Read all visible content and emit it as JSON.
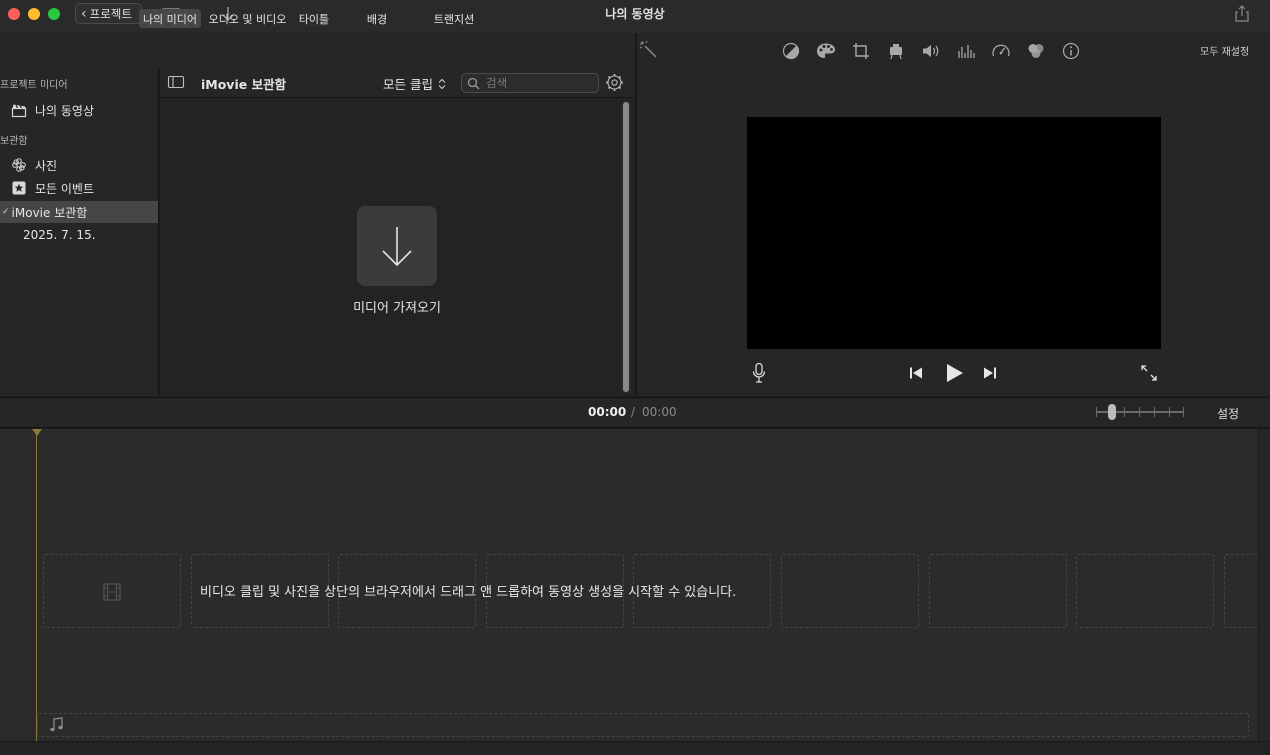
{
  "window": {
    "title": "나의 동영상",
    "back_label": "프로젝트",
    "traffic_colors": [
      "#ff5f57",
      "#febc2e",
      "#28c840"
    ]
  },
  "browser_tabs": [
    {
      "label": "나의 미디어",
      "active": true
    },
    {
      "label": "오디오 및 비디오",
      "active": false
    },
    {
      "label": "타이틀",
      "active": false
    },
    {
      "label": "배경",
      "active": false
    },
    {
      "label": "트랜지션",
      "active": false
    }
  ],
  "sidebar": {
    "project_media_header": "프로젝트 미디어",
    "project_item": "나의 동영상",
    "library_header": "보관함",
    "photos": "사진",
    "all_events": "모든 이벤트",
    "library_item": "iMovie 보관함",
    "event_date": "2025. 7. 15."
  },
  "browser": {
    "title": "iMovie 보관함",
    "filter_label": "모든 클립",
    "search_placeholder": "검색",
    "import_label": "미디어 가져오기"
  },
  "viewer": {
    "reset_all": "모두 재설정",
    "adjust_icons": [
      "magic-wand-icon",
      "color-balance-icon",
      "color-palette-icon",
      "crop-icon",
      "stabilization-camera-icon",
      "volume-icon",
      "equalizer-icon",
      "speed-icon",
      "clip-filter-icon",
      "info-icon"
    ]
  },
  "timeline": {
    "current_time": "00:00",
    "separator": "/",
    "total_time": "00:00",
    "settings_label": "설정",
    "drop_hint": "비디오 클립 및 사진을 상단의 브라우저에서 드래그 앤 드롭하여 동영상 생성을 시작할 수 있습니다."
  }
}
